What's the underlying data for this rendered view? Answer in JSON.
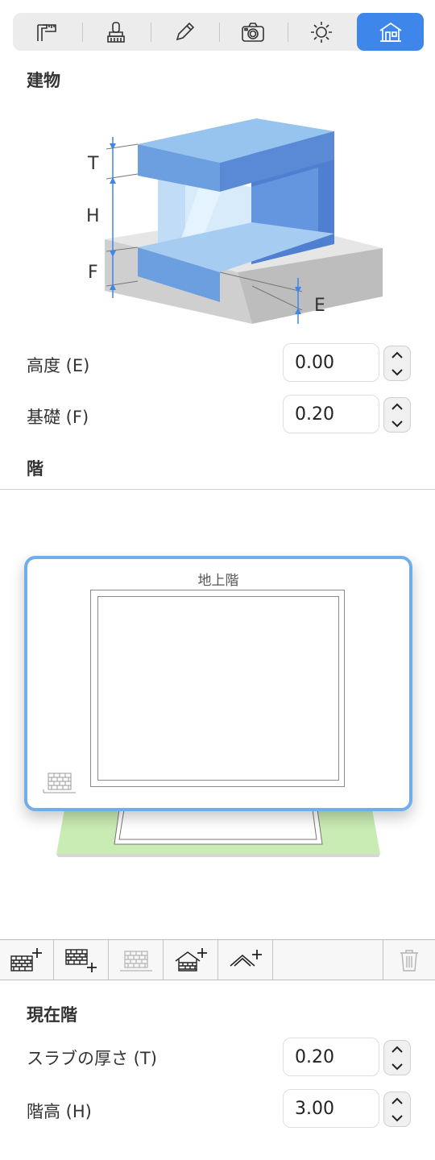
{
  "tabs": [
    {
      "icon": "measure-icon",
      "active": false
    },
    {
      "icon": "brush-icon",
      "active": false
    },
    {
      "icon": "pencil-icon",
      "active": false
    },
    {
      "icon": "camera-icon",
      "active": false
    },
    {
      "icon": "sun-icon",
      "active": false
    },
    {
      "icon": "house-icon",
      "active": true
    }
  ],
  "building": {
    "title": "建物",
    "diagram_labels": {
      "t": "T",
      "h": "H",
      "f": "F",
      "e": "E"
    },
    "elevation_label": "高度 (E)",
    "elevation_value": "0.00",
    "foundation_label": "基礎 (F)",
    "foundation_value": "0.20"
  },
  "floors": {
    "title": "階",
    "card_title": "地上階"
  },
  "floor_toolbar": [
    {
      "icon": "add-floor-above-icon",
      "enabled": true
    },
    {
      "icon": "add-floor-below-icon",
      "enabled": true
    },
    {
      "icon": "floor-disabled-icon",
      "enabled": false
    },
    {
      "icon": "add-roof-floor-icon",
      "enabled": true
    },
    {
      "icon": "add-roof-icon",
      "enabled": true
    },
    {
      "icon": "trash-icon",
      "enabled": false
    }
  ],
  "current_floor": {
    "title": "現在階",
    "slab_label": "スラブの厚さ (T)",
    "slab_value": "0.20",
    "height_label": "階高 (H)",
    "height_value": "3.00"
  },
  "colors": {
    "accent": "#3f86ea",
    "card_border": "#70aeea",
    "ground": "#c9ecb4"
  }
}
